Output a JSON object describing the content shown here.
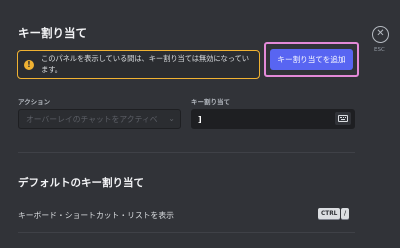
{
  "header": {
    "title": "キー割り当て"
  },
  "warning": {
    "icon": "warning-icon",
    "text_line1": "このパネルを表示している間は、キー割り当ては無効になってい",
    "text_line2": "ます。"
  },
  "add_button": {
    "label": "キー割り当てを追加",
    "highlight_color": "#e38ad8",
    "color": "#5865f2"
  },
  "close": {
    "icon": "close-icon",
    "symbol": "✕",
    "esc_label": "ESC"
  },
  "fields": {
    "action_label": "アクション",
    "action_value": "オーバーレイのチャットをアクティベ",
    "keybind_label": "キー割り当て",
    "keybind_value": "]"
  },
  "defaults": {
    "title": "デフォルトのキー割り当て",
    "rows": [
      {
        "label": "キーボード・ショートカット・リストを表示",
        "keys": [
          "CTRL",
          "/"
        ]
      }
    ]
  }
}
